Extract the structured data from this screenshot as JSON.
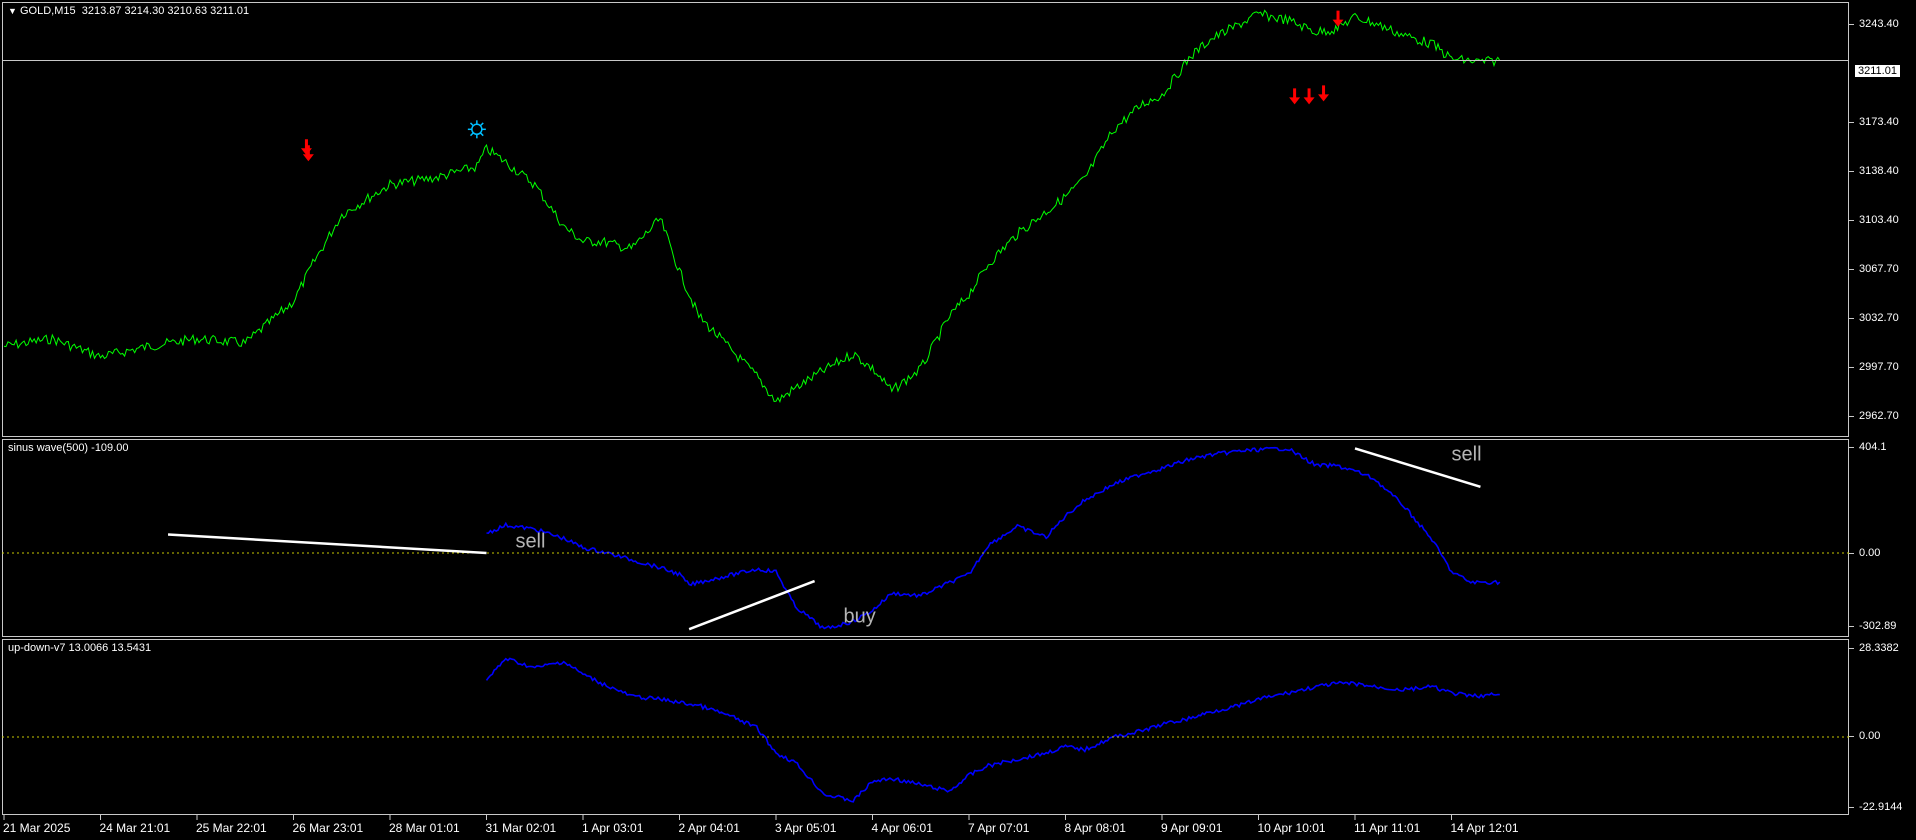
{
  "colors": {
    "background": "#000000",
    "price_line": "#00ff00",
    "indicator_line": "#0000ff",
    "zero_line": "#c8c800",
    "trend_line": "#ffffff",
    "annotation_text": "#b4b4b4",
    "sell_arrow": "#ff0000",
    "star_marker": "#00bfff",
    "axis_text": "#ffffff",
    "frame": "#c8c8c8"
  },
  "price_pane": {
    "title": "GOLD,M15  3213.87 3214.30 3210.63 3211.01",
    "collapse_icon": "triangle-down-icon",
    "current_price": "3211.01",
    "yticks": [
      "3243.40",
      "3211.01",
      "3173.40",
      "3138.40",
      "3103.40",
      "3067.70",
      "3032.70",
      "2997.70",
      "2962.70"
    ],
    "markers": [
      {
        "type": "sell-arrow-icon",
        "x": 31.6,
        "y": 3149
      },
      {
        "type": "sell-arrow-icon",
        "x": 31.8,
        "y": 3145
      },
      {
        "type": "star-icon",
        "x": 49.0,
        "y": 3165
      },
      {
        "type": "sell-arrow-icon",
        "x": 134.0,
        "y": 3183
      },
      {
        "type": "sell-arrow-icon",
        "x": 135.5,
        "y": 3183
      },
      {
        "type": "sell-arrow-icon",
        "x": 137.0,
        "y": 3185
      },
      {
        "type": "sell-arrow-icon",
        "x": 138.5,
        "y": 3235
      }
    ]
  },
  "sinus_pane": {
    "title": "sinus wave(500) -109.00",
    "yticks": [
      "404.1",
      "0.00",
      "-302.89"
    ],
    "annotations": [
      {
        "text": "sell",
        "x": 53,
        "y": 20
      },
      {
        "text": "buy",
        "x": 87,
        "y": -260
      },
      {
        "text": "sell",
        "x": 150,
        "y": 350
      }
    ],
    "trend_lines": [
      {
        "x1": 17,
        "y1": 70,
        "x2": 50,
        "y2": 0
      },
      {
        "x1": 71,
        "y1": -285,
        "x2": 84,
        "y2": -105
      },
      {
        "x1": 140,
        "y1": 395,
        "x2": 153,
        "y2": 250
      }
    ]
  },
  "updown_pane": {
    "title": "up-down-v7 13.0066 13.5431",
    "yticks": [
      "28.3382",
      "0.00",
      "-22.9144"
    ]
  },
  "x_axis": {
    "labels": [
      "21 Mar 2025",
      "24 Mar 21:01",
      "25 Mar 22:01",
      "26 Mar 23:01",
      "28 Mar 01:01",
      "31 Mar 02:01",
      "1 Apr 03:01",
      "2 Apr 04:01",
      "3 Apr 05:01",
      "4 Apr 06:01",
      "7 Apr 07:01",
      "8 Apr 08:01",
      "9 Apr 09:01",
      "10 Apr 10:01",
      "11 Apr 11:01",
      "14 Apr 12:01"
    ]
  },
  "chart_data": [
    {
      "type": "line",
      "title": "GOLD,M15",
      "x_unit": "bar index (label every 10)",
      "x": [
        0,
        5,
        10,
        15,
        20,
        25,
        30,
        32,
        35,
        40,
        45,
        49,
        50,
        52,
        55,
        58,
        60,
        62,
        65,
        68,
        70,
        72,
        75,
        78,
        80,
        82,
        85,
        88,
        90,
        92,
        95,
        98,
        100,
        102,
        105,
        108,
        110,
        112,
        115,
        118,
        120,
        123,
        125,
        128,
        130,
        133,
        136,
        138,
        140,
        142,
        145,
        148,
        150,
        153,
        155
      ],
      "series": [
        {
          "values": [
            3020,
            3025,
            3013,
            3020,
            3025,
            3022,
            3050,
            3075,
            3108,
            3128,
            3133,
            3140,
            3152,
            3143,
            3128,
            3100,
            3090,
            3090,
            3085,
            3105,
            3070,
            3040,
            3020,
            3000,
            2983,
            2992,
            3004,
            3015,
            3005,
            2990,
            3005,
            3040,
            3055,
            3075,
            3095,
            3110,
            3120,
            3132,
            3165,
            3182,
            3188,
            3214,
            3225,
            3235,
            3242,
            3238,
            3230,
            3232,
            3240,
            3236,
            3228,
            3222,
            3212,
            3210,
            3211
          ]
        }
      ],
      "ylim": [
        2962.7,
        3243.4
      ]
    },
    {
      "type": "line",
      "title": "sinus wave(500) -109.00",
      "x_unit": "bar index (label every 10)",
      "x": [
        50,
        52,
        55,
        58,
        60,
        62,
        65,
        68,
        70,
        71,
        72,
        75,
        78,
        80,
        82,
        85,
        88,
        90,
        92,
        95,
        98,
        100,
        102,
        105,
        108,
        110,
        112,
        115,
        118,
        120,
        123,
        125,
        128,
        130,
        133,
        136,
        138,
        140,
        142,
        145,
        148,
        150,
        152,
        155
      ],
      "series": [
        {
          "values": [
            75,
            105,
            90,
            55,
            20,
            5,
            -25,
            -55,
            -80,
            -120,
            -110,
            -85,
            -60,
            -70,
            -200,
            -285,
            -255,
            -215,
            -150,
            -160,
            -110,
            -80,
            30,
            100,
            60,
            140,
            200,
            260,
            300,
            320,
            355,
            370,
            385,
            390,
            395,
            330,
            330,
            310,
            280,
            180,
            50,
            -70,
            -110,
            -109
          ]
        }
      ],
      "ylim": [
        -302.89,
        404.1
      ]
    },
    {
      "type": "line",
      "title": "up-down-v7 13.0066 13.5431",
      "x_unit": "bar index (label every 10)",
      "x": [
        50,
        52,
        55,
        58,
        60,
        62,
        65,
        68,
        70,
        72,
        75,
        78,
        80,
        82,
        85,
        88,
        90,
        92,
        95,
        98,
        100,
        102,
        105,
        108,
        110,
        112,
        115,
        118,
        120,
        123,
        125,
        128,
        130,
        133,
        136,
        138,
        140,
        142,
        145,
        148,
        150,
        152,
        155
      ],
      "series": [
        {
          "values": [
            18,
            25,
            22,
            24,
            20,
            17,
            13,
            12,
            11,
            10,
            7,
            3,
            -5,
            -8,
            -18,
            -20,
            -14,
            -13,
            -15,
            -17,
            -12,
            -9,
            -7,
            -5,
            -3,
            -4,
            0,
            2,
            4,
            6,
            8,
            10,
            12,
            14,
            16,
            17,
            17,
            16,
            15,
            16,
            14,
            13,
            13.5
          ]
        }
      ],
      "ylim": [
        -22.9144,
        28.3382
      ]
    }
  ]
}
